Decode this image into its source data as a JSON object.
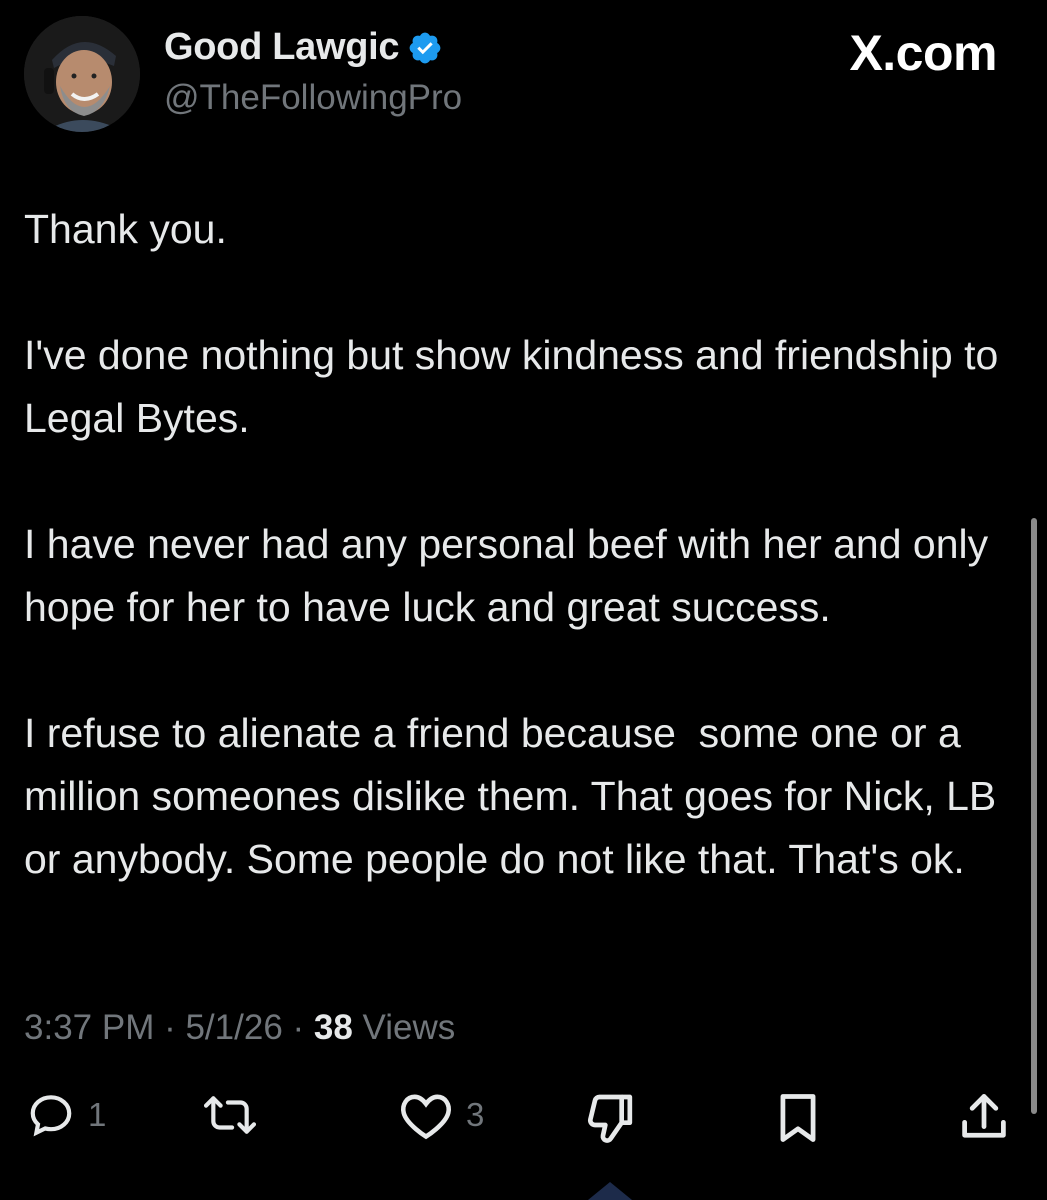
{
  "author": {
    "display_name": "Good Lawgic",
    "handle": "@TheFollowingPro",
    "verified": true,
    "avatar_icon": "profile-photo"
  },
  "brand": {
    "label": "X.com"
  },
  "tweet": {
    "paragraphs": [
      "Thank you.",
      "I've done nothing but show kindness and friendship to Legal Bytes.",
      "I have never had any personal beef with her and only hope for her to have luck and great success.",
      "I refuse to alienate a friend because  some one or a million someones dislike them. That goes for Nick, LB or anybody. Some people do not like that. That's ok."
    ]
  },
  "meta": {
    "time": "3:37 PM",
    "separator": " · ",
    "date": "5/1/26",
    "views_count": "38",
    "views_label": " Views"
  },
  "actions": {
    "reply_count": "1",
    "repost_count": "",
    "like_count": "3"
  },
  "colors": {
    "background": "#000000",
    "text_primary": "#e7e9ea",
    "text_secondary": "#71767b",
    "verified": "#1d9bf0"
  }
}
